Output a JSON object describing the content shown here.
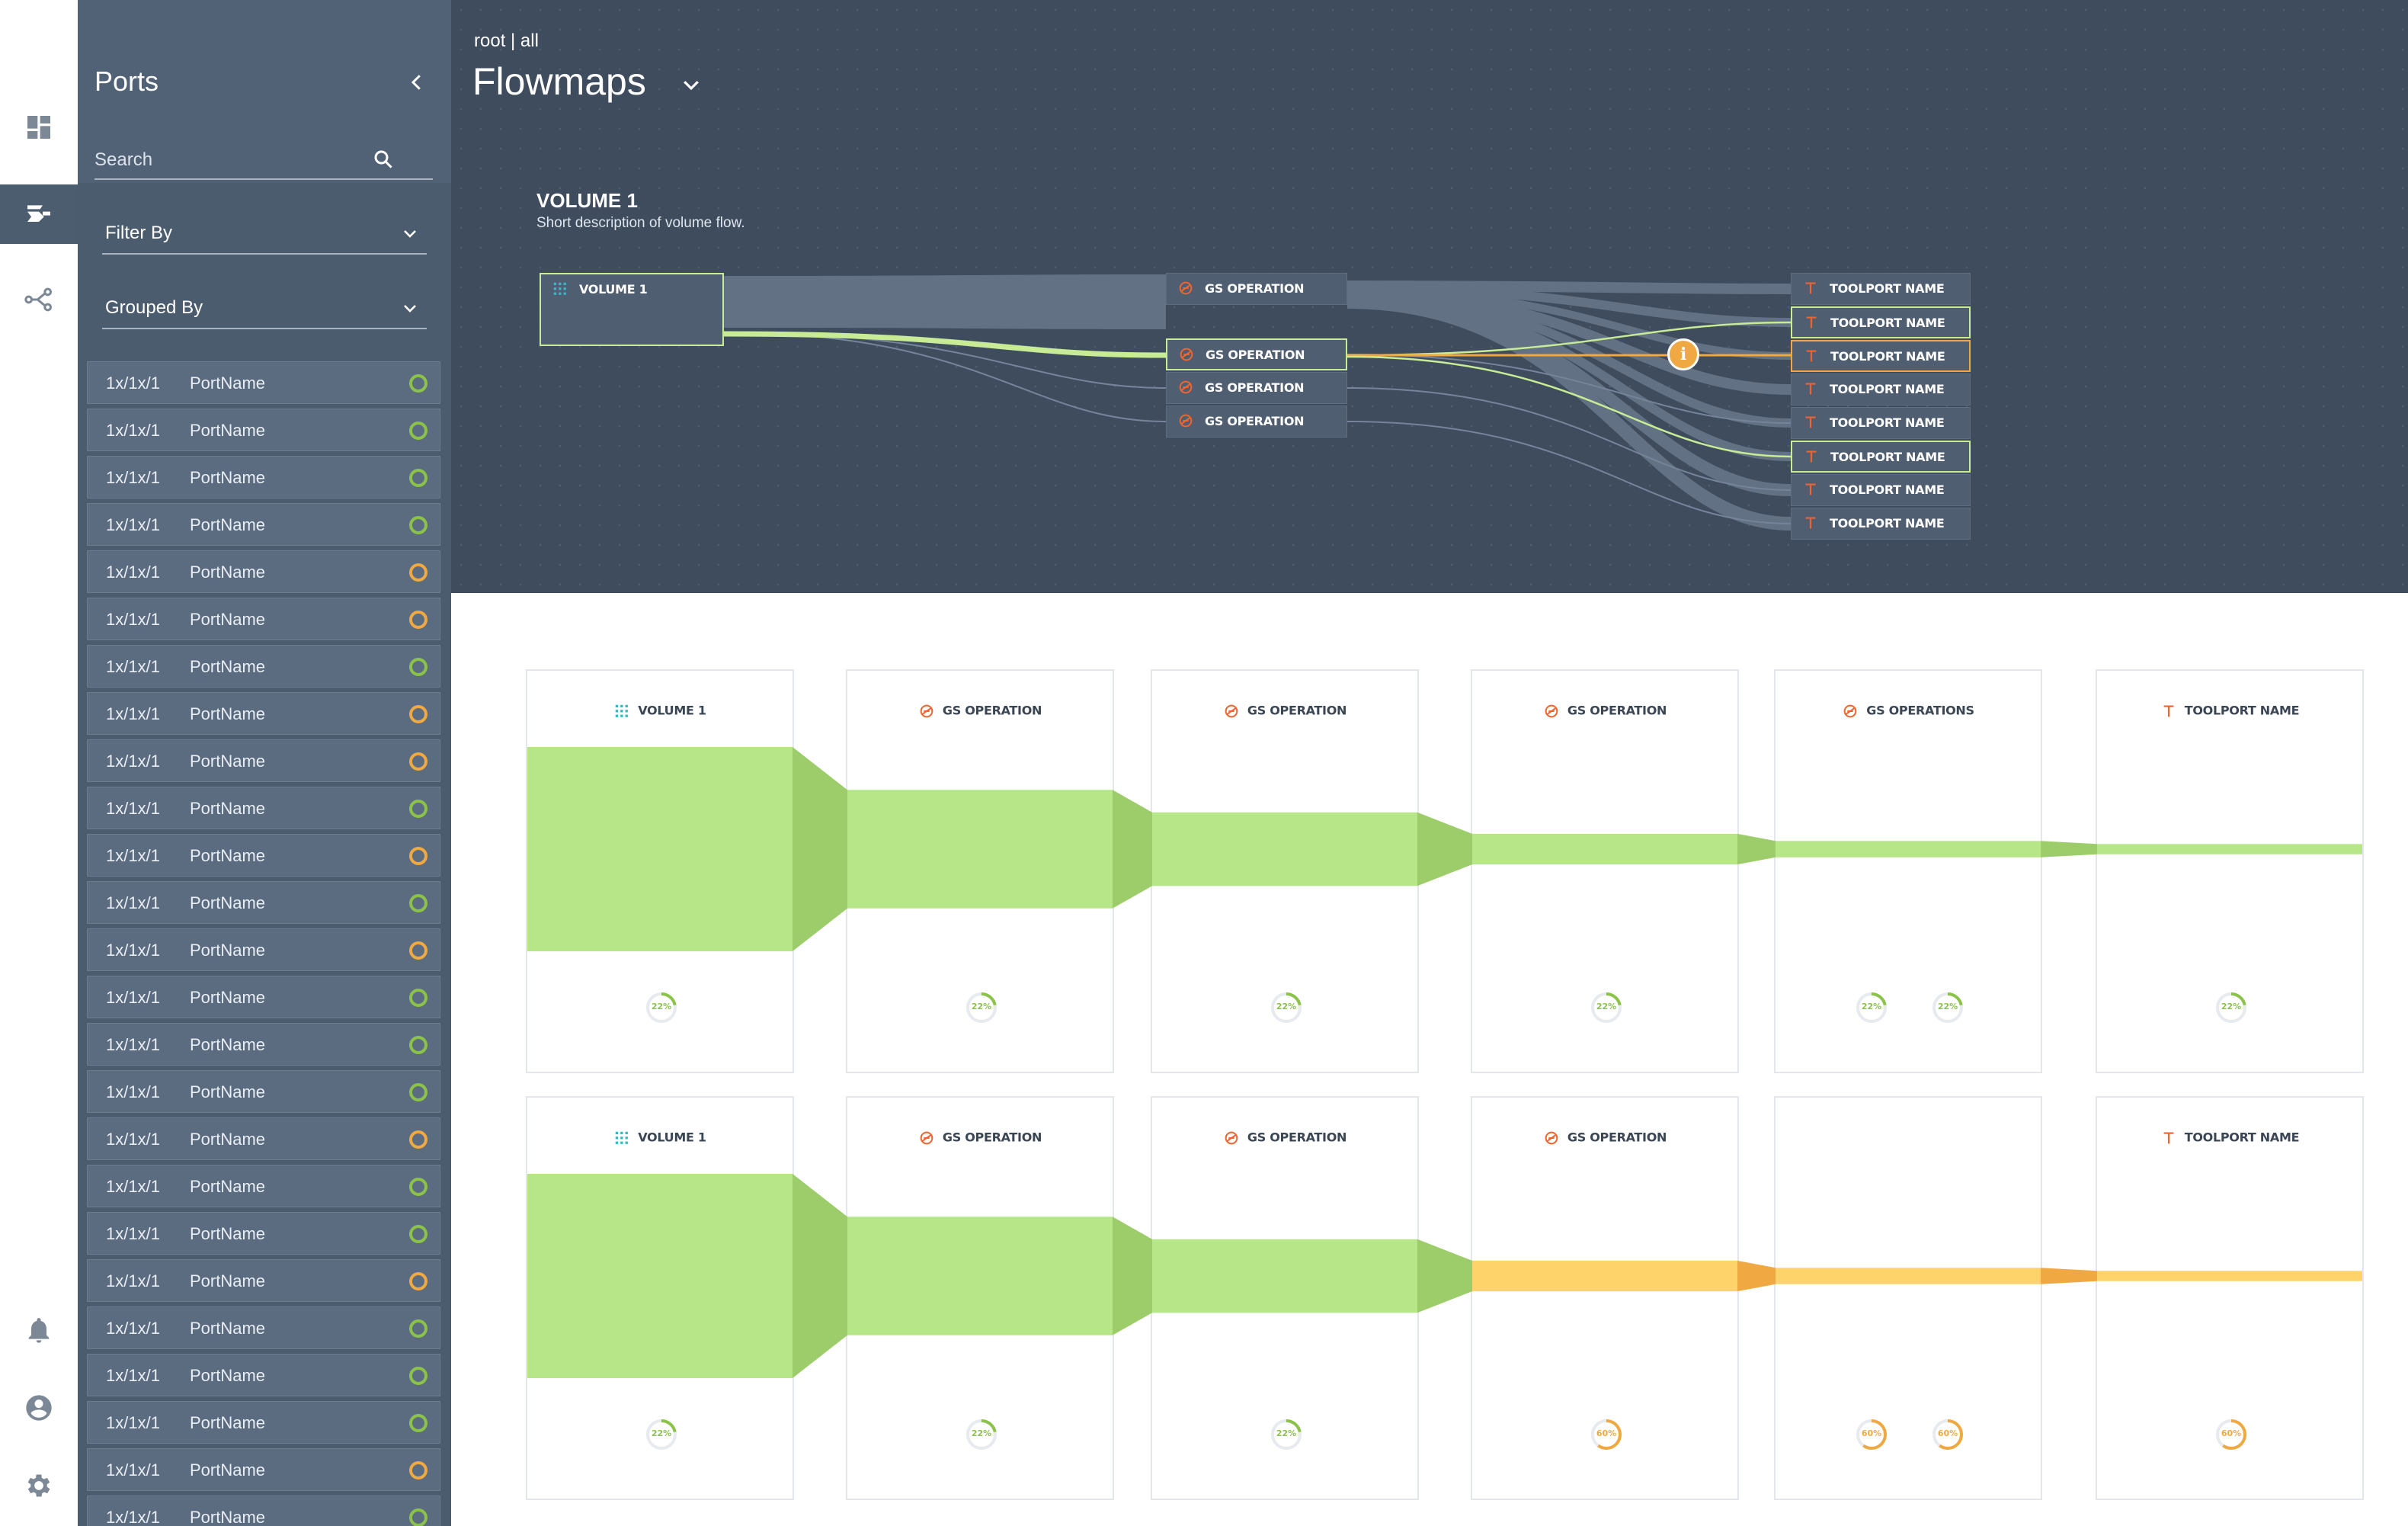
{
  "header": {
    "breadcrumb": "root | all",
    "title": "Flowmaps"
  },
  "rail": {
    "items": [
      {
        "icon": "dashboard-icon"
      },
      {
        "icon": "flowmaps-icon",
        "active": true
      },
      {
        "icon": "topology-icon"
      },
      {
        "icon": "bell-icon"
      },
      {
        "icon": "user-icon"
      },
      {
        "icon": "gear-icon"
      }
    ]
  },
  "sidebar": {
    "title": "Ports",
    "search_placeholder": "Search",
    "filter_label": "Filter By",
    "group_label": "Grouped By",
    "ports": [
      {
        "id": "1x/1x/1",
        "name": "PortName",
        "status": "ok"
      },
      {
        "id": "1x/1x/1",
        "name": "PortName",
        "status": "ok"
      },
      {
        "id": "1x/1x/1",
        "name": "PortName",
        "status": "ok"
      },
      {
        "id": "1x/1x/1",
        "name": "PortName",
        "status": "ok"
      },
      {
        "id": "1x/1x/1",
        "name": "PortName",
        "status": "warn"
      },
      {
        "id": "1x/1x/1",
        "name": "PortName",
        "status": "warn"
      },
      {
        "id": "1x/1x/1",
        "name": "PortName",
        "status": "ok"
      },
      {
        "id": "1x/1x/1",
        "name": "PortName",
        "status": "warn"
      },
      {
        "id": "1x/1x/1",
        "name": "PortName",
        "status": "warn"
      },
      {
        "id": "1x/1x/1",
        "name": "PortName",
        "status": "ok"
      },
      {
        "id": "1x/1x/1",
        "name": "PortName",
        "status": "warn"
      },
      {
        "id": "1x/1x/1",
        "name": "PortName",
        "status": "ok"
      },
      {
        "id": "1x/1x/1",
        "name": "PortName",
        "status": "warn"
      },
      {
        "id": "1x/1x/1",
        "name": "PortName",
        "status": "ok"
      },
      {
        "id": "1x/1x/1",
        "name": "PortName",
        "status": "ok"
      },
      {
        "id": "1x/1x/1",
        "name": "PortName",
        "status": "ok"
      },
      {
        "id": "1x/1x/1",
        "name": "PortName",
        "status": "warn"
      },
      {
        "id": "1x/1x/1",
        "name": "PortName",
        "status": "ok"
      },
      {
        "id": "1x/1x/1",
        "name": "PortName",
        "status": "ok"
      },
      {
        "id": "1x/1x/1",
        "name": "PortName",
        "status": "warn"
      },
      {
        "id": "1x/1x/1",
        "name": "PortName",
        "status": "ok"
      },
      {
        "id": "1x/1x/1",
        "name": "PortName",
        "status": "ok"
      },
      {
        "id": "1x/1x/1",
        "name": "PortName",
        "status": "ok"
      },
      {
        "id": "1x/1x/1",
        "name": "PortName",
        "status": "warn"
      },
      {
        "id": "1x/1x/1",
        "name": "PortName",
        "status": "ok"
      }
    ]
  },
  "flowmap": {
    "volume_title": "VOLUME 1",
    "volume_desc": "Short description of volume flow.",
    "source": {
      "label": "VOLUME 1"
    },
    "operations": [
      {
        "label": "GS OPERATION"
      },
      {
        "label": "GS OPERATION",
        "selected": true
      },
      {
        "label": "GS OPERATION"
      },
      {
        "label": "GS OPERATION"
      }
    ],
    "toolports": [
      {
        "label": "TOOLPORT NAME"
      },
      {
        "label": "TOOLPORT NAME",
        "selected": "green"
      },
      {
        "label": "TOOLPORT NAME",
        "selected": "orange"
      },
      {
        "label": "TOOLPORT NAME"
      },
      {
        "label": "TOOLPORT NAME"
      },
      {
        "label": "TOOLPORT NAME",
        "selected": "green"
      },
      {
        "label": "TOOLPORT NAME"
      },
      {
        "label": "TOOLPORT NAME"
      }
    ],
    "info_badge": "i"
  },
  "flow_cards": [
    {
      "color": "#b7e689",
      "join_color": "#9ccd6a",
      "band_fraction": [
        1.0,
        0.58,
        0.36,
        0.15,
        0.08,
        0.05
      ],
      "cards": [
        {
          "icon": "volume-icon",
          "label": "VOLUME 1",
          "donuts": [
            {
              "text": "22%",
              "pct": 0.22,
              "color": "#8bc34a"
            }
          ]
        },
        {
          "icon": "gs-operation-icon",
          "label": "GS OPERATION",
          "donuts": [
            {
              "text": "22%",
              "pct": 0.22,
              "color": "#8bc34a"
            }
          ]
        },
        {
          "icon": "gs-operation-icon",
          "label": "GS OPERATION",
          "donuts": [
            {
              "text": "22%",
              "pct": 0.22,
              "color": "#8bc34a"
            }
          ]
        },
        {
          "icon": "gs-operation-icon",
          "label": "GS OPERATION",
          "donuts": [
            {
              "text": "22%",
              "pct": 0.22,
              "color": "#8bc34a"
            }
          ]
        },
        {
          "icon": "gs-operation-icon",
          "label": "GS OPERATIONS",
          "donuts": [
            {
              "text": "22%",
              "pct": 0.22,
              "color": "#8bc34a"
            },
            {
              "text": "22%",
              "pct": 0.22,
              "color": "#8bc34a"
            }
          ]
        },
        {
          "icon": "toolport-icon",
          "label": "TOOLPORT NAME",
          "donuts": [
            {
              "text": "22%",
              "pct": 0.22,
              "color": "#8bc34a"
            }
          ]
        }
      ]
    },
    {
      "color": "#b7e689",
      "join_color": "#9ccd6a",
      "alt_color": "#fdd36a",
      "alt_join_color": "#f0a942",
      "alt_from": 3,
      "band_fraction": [
        1.0,
        0.58,
        0.36,
        0.15,
        0.08,
        0.05
      ],
      "cards": [
        {
          "icon": "volume-icon",
          "label": "VOLUME 1",
          "donuts": [
            {
              "text": "22%",
              "pct": 0.22,
              "color": "#8bc34a"
            }
          ]
        },
        {
          "icon": "gs-operation-icon",
          "label": "GS OPERATION",
          "donuts": [
            {
              "text": "22%",
              "pct": 0.22,
              "color": "#8bc34a"
            }
          ]
        },
        {
          "icon": "gs-operation-icon",
          "label": "GS OPERATION",
          "donuts": [
            {
              "text": "22%",
              "pct": 0.22,
              "color": "#8bc34a"
            }
          ]
        },
        {
          "icon": "gs-operation-icon",
          "label": "GS OPERATION",
          "donuts": [
            {
              "text": "60%",
              "pct": 0.6,
              "color": "#f0a942"
            }
          ]
        },
        {
          "icon": "",
          "label": "",
          "donuts": [
            {
              "text": "60%",
              "pct": 0.6,
              "color": "#f0a942"
            },
            {
              "text": "60%",
              "pct": 0.6,
              "color": "#f0a942"
            }
          ]
        },
        {
          "icon": "toolport-icon",
          "label": "TOOLPORT NAME",
          "donuts": [
            {
              "text": "60%",
              "pct": 0.6,
              "color": "#f0a942"
            }
          ]
        }
      ]
    }
  ],
  "colors": {
    "ok": "#8bc34a",
    "warn": "#f0a942",
    "accent_orange": "#f0642f",
    "volume_teal": "#39b6c9"
  }
}
